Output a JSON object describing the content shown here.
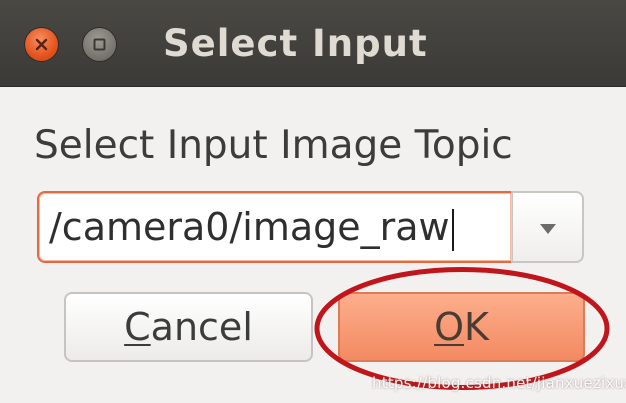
{
  "window": {
    "title": "Select Input",
    "controls": {
      "close_icon": "close-icon",
      "maximize_icon": "maximize-icon"
    }
  },
  "dialog": {
    "label": "Select Input Image Topic",
    "topic_combo": {
      "value": "/camera0/image_raw",
      "dropdown_icon": "chevron-down-icon"
    },
    "buttons": {
      "cancel": {
        "mnemonic": "C",
        "rest": "ancel"
      },
      "ok": {
        "mnemonic": "O",
        "rest": "K"
      }
    }
  },
  "annotation": {
    "shape": "ellipse",
    "target": "ok-button",
    "color": "#c0151b"
  },
  "watermark": "https://blog.csdn.net/jianxuezixuan",
  "colors": {
    "titlebar": "#3d3b37",
    "close_button": "#e3531f",
    "focus_border": "#e46a3f",
    "ok_button": "#f5936b"
  }
}
